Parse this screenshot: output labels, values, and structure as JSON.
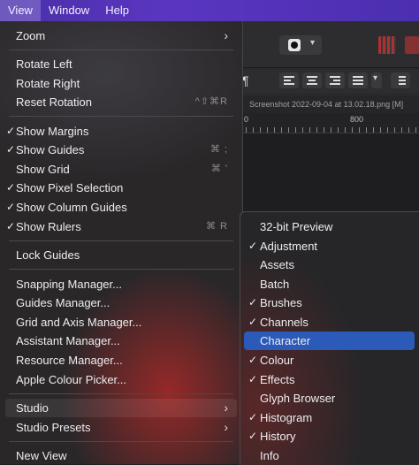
{
  "menubar": {
    "items": [
      "View",
      "Window",
      "Help"
    ]
  },
  "document": {
    "tab_title": "Screenshot 2022-09-04 at 13.02.18.png [M]",
    "ruler_labels": [
      "0",
      "800"
    ]
  },
  "view_menu": {
    "zoom": "Zoom",
    "rotate_left": "Rotate Left",
    "rotate_right": "Rotate Right",
    "reset_rotation": "Reset Rotation",
    "reset_rotation_shortcut": "^⇧⌘R",
    "show_margins": "Show Margins",
    "show_guides": "Show Guides",
    "show_guides_shortcut": "⌘ ;",
    "show_grid": "Show Grid",
    "show_grid_shortcut": "⌘ '",
    "show_pixel_selection": "Show Pixel Selection",
    "show_column_guides": "Show Column Guides",
    "show_rulers": "Show Rulers",
    "show_rulers_shortcut": "⌘ R",
    "lock_guides": "Lock Guides",
    "snapping_manager": "Snapping Manager...",
    "guides_manager": "Guides Manager...",
    "grid_axis_manager": "Grid and Axis Manager...",
    "assistant_manager": "Assistant Manager...",
    "resource_manager": "Resource Manager...",
    "apple_colour_picker": "Apple Colour Picker...",
    "studio": "Studio",
    "studio_presets": "Studio Presets",
    "new_view": "New View"
  },
  "studio_menu": {
    "items": [
      {
        "label": "32-bit Preview",
        "checked": false
      },
      {
        "label": "Adjustment",
        "checked": true
      },
      {
        "label": "Assets",
        "checked": false
      },
      {
        "label": "Batch",
        "checked": false
      },
      {
        "label": "Brushes",
        "checked": true
      },
      {
        "label": "Channels",
        "checked": true
      },
      {
        "label": "Character",
        "checked": false,
        "highlighted": true
      },
      {
        "label": "Colour",
        "checked": true
      },
      {
        "label": "Effects",
        "checked": true
      },
      {
        "label": "Glyph Browser",
        "checked": false
      },
      {
        "label": "Histogram",
        "checked": true
      },
      {
        "label": "History",
        "checked": true
      },
      {
        "label": "Info",
        "checked": false
      }
    ]
  },
  "glyphs": {
    "check": "✓",
    "chevron": "›"
  },
  "colors": {
    "menubar": "#4a2fa8",
    "highlight": "#2c5ab8"
  }
}
